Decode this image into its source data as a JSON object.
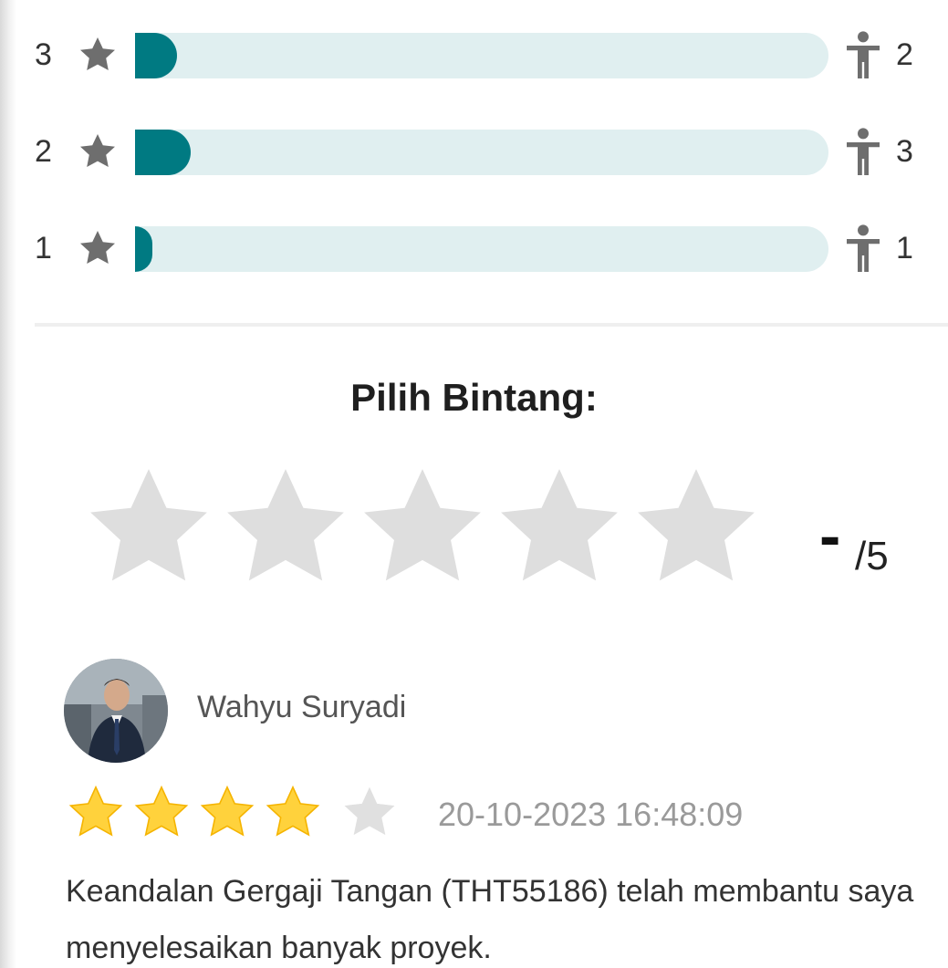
{
  "distribution": [
    {
      "stars_label": "3",
      "count": "2",
      "fill_fraction": 0.06
    },
    {
      "stars_label": "2",
      "count": "3",
      "fill_fraction": 0.08
    },
    {
      "stars_label": "1",
      "count": "1",
      "fill_fraction": 0.025
    }
  ],
  "picker": {
    "title": "Pilih Bintang:",
    "star_count": 5,
    "selected_value": "-",
    "max_label": "/5",
    "empty_star_color": "#dedede"
  },
  "review": {
    "name": "Wahyu Suryadi",
    "rating": 4,
    "max_rating": 5,
    "date": "20-10-2023 16:48:09",
    "text": "Keandalan Gergaji Tangan (THT55186) telah membantu saya menyelesaikan banyak proyek.",
    "filled_star_color": "#ffd23c",
    "empty_star_color": "#e0e0e0"
  },
  "colors": {
    "bar_fill": "#007a82",
    "bar_track": "#e0eff0",
    "icon_gray": "#6e6e6e"
  },
  "icons": {
    "dist_star": "star-icon",
    "person": "person-icon"
  }
}
